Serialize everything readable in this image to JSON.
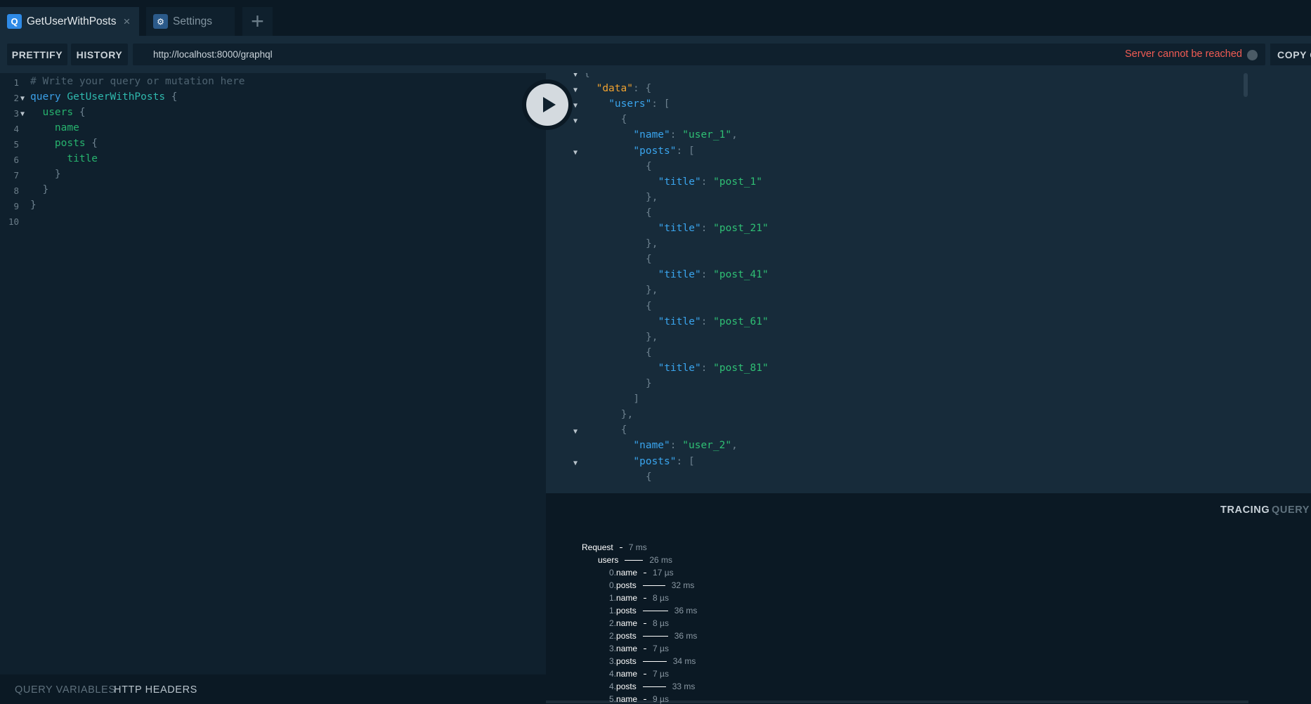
{
  "tabs": [
    {
      "badge": "Q",
      "label": "GetUserWithPosts",
      "close": "×"
    },
    {
      "badge": "⚙",
      "label": "Settings"
    }
  ],
  "add_tab_label": "+",
  "toolbar": {
    "prettify": "PRETTIFY",
    "history": "HISTORY",
    "url": "http://localhost:8000/graphql",
    "server_status": "Server cannot be reached",
    "copy": "COPY CURL"
  },
  "editor": {
    "lines": [
      {
        "num": "1",
        "fold": "",
        "segs": [
          {
            "t": "# Write your query or mutation here",
            "c": "c-comment"
          }
        ]
      },
      {
        "num": "2",
        "fold": "▼",
        "segs": [
          {
            "t": "query ",
            "c": "c-kw"
          },
          {
            "t": "GetUserWithPosts",
            "c": "c-def"
          },
          {
            "t": " {",
            "c": "c-punct"
          }
        ]
      },
      {
        "num": "3",
        "fold": "▼",
        "segs": [
          {
            "t": "  users",
            "c": "c-field"
          },
          {
            "t": " {",
            "c": "c-punct"
          }
        ]
      },
      {
        "num": "4",
        "fold": "",
        "segs": [
          {
            "t": "    name",
            "c": "c-field"
          }
        ]
      },
      {
        "num": "5",
        "fold": "",
        "segs": [
          {
            "t": "    posts",
            "c": "c-field"
          },
          {
            "t": " {",
            "c": "c-punct"
          }
        ]
      },
      {
        "num": "6",
        "fold": "",
        "segs": [
          {
            "t": "      title",
            "c": "c-field"
          }
        ]
      },
      {
        "num": "7",
        "fold": "",
        "segs": [
          {
            "t": "    }",
            "c": "c-punct"
          }
        ]
      },
      {
        "num": "8",
        "fold": "",
        "segs": [
          {
            "t": "  }",
            "c": "c-punct"
          }
        ]
      },
      {
        "num": "9",
        "fold": "",
        "segs": [
          {
            "t": "}",
            "c": "c-punct"
          }
        ]
      },
      {
        "num": "10",
        "fold": "",
        "segs": []
      }
    ]
  },
  "bottom_tabs": {
    "variables": "QUERY VARIABLES",
    "headers": "HTTP HEADERS"
  },
  "result": {
    "lines": [
      {
        "fold": "▼",
        "indent": 0,
        "segs": [
          {
            "t": "{",
            "c": "j-p"
          }
        ]
      },
      {
        "fold": "▼",
        "indent": 1,
        "segs": [
          {
            "t": "\"data\"",
            "c": "j-k-top"
          },
          {
            "t": ": {",
            "c": "j-p"
          }
        ]
      },
      {
        "fold": "▼",
        "indent": 2,
        "segs": [
          {
            "t": "\"users\"",
            "c": "j-k"
          },
          {
            "t": ": [",
            "c": "j-p"
          }
        ]
      },
      {
        "fold": "▼",
        "indent": 3,
        "segs": [
          {
            "t": "{",
            "c": "j-p"
          }
        ]
      },
      {
        "fold": "",
        "indent": 4,
        "segs": [
          {
            "t": "\"name\"",
            "c": "j-k"
          },
          {
            "t": ": ",
            "c": "j-p"
          },
          {
            "t": "\"user_1\"",
            "c": "j-s"
          },
          {
            "t": ",",
            "c": "j-p"
          }
        ]
      },
      {
        "fold": "▼",
        "indent": 4,
        "segs": [
          {
            "t": "\"posts\"",
            "c": "j-k"
          },
          {
            "t": ": [",
            "c": "j-p"
          }
        ]
      },
      {
        "fold": "",
        "indent": 5,
        "segs": [
          {
            "t": "{",
            "c": "j-p"
          }
        ]
      },
      {
        "fold": "",
        "indent": 6,
        "segs": [
          {
            "t": "\"title\"",
            "c": "j-k"
          },
          {
            "t": ": ",
            "c": "j-p"
          },
          {
            "t": "\"post_1\"",
            "c": "j-s"
          }
        ]
      },
      {
        "fold": "",
        "indent": 5,
        "segs": [
          {
            "t": "},",
            "c": "j-p"
          }
        ]
      },
      {
        "fold": "",
        "indent": 5,
        "segs": [
          {
            "t": "{",
            "c": "j-p"
          }
        ]
      },
      {
        "fold": "",
        "indent": 6,
        "segs": [
          {
            "t": "\"title\"",
            "c": "j-k"
          },
          {
            "t": ": ",
            "c": "j-p"
          },
          {
            "t": "\"post_21\"",
            "c": "j-s"
          }
        ]
      },
      {
        "fold": "",
        "indent": 5,
        "segs": [
          {
            "t": "},",
            "c": "j-p"
          }
        ]
      },
      {
        "fold": "",
        "indent": 5,
        "segs": [
          {
            "t": "{",
            "c": "j-p"
          }
        ]
      },
      {
        "fold": "",
        "indent": 6,
        "segs": [
          {
            "t": "\"title\"",
            "c": "j-k"
          },
          {
            "t": ": ",
            "c": "j-p"
          },
          {
            "t": "\"post_41\"",
            "c": "j-s"
          }
        ]
      },
      {
        "fold": "",
        "indent": 5,
        "segs": [
          {
            "t": "},",
            "c": "j-p"
          }
        ]
      },
      {
        "fold": "",
        "indent": 5,
        "segs": [
          {
            "t": "{",
            "c": "j-p"
          }
        ]
      },
      {
        "fold": "",
        "indent": 6,
        "segs": [
          {
            "t": "\"title\"",
            "c": "j-k"
          },
          {
            "t": ": ",
            "c": "j-p"
          },
          {
            "t": "\"post_61\"",
            "c": "j-s"
          }
        ]
      },
      {
        "fold": "",
        "indent": 5,
        "segs": [
          {
            "t": "},",
            "c": "j-p"
          }
        ]
      },
      {
        "fold": "",
        "indent": 5,
        "segs": [
          {
            "t": "{",
            "c": "j-p"
          }
        ]
      },
      {
        "fold": "",
        "indent": 6,
        "segs": [
          {
            "t": "\"title\"",
            "c": "j-k"
          },
          {
            "t": ": ",
            "c": "j-p"
          },
          {
            "t": "\"post_81\"",
            "c": "j-s"
          }
        ]
      },
      {
        "fold": "",
        "indent": 5,
        "segs": [
          {
            "t": "}",
            "c": "j-p"
          }
        ]
      },
      {
        "fold": "",
        "indent": 4,
        "segs": [
          {
            "t": "]",
            "c": "j-p"
          }
        ]
      },
      {
        "fold": "",
        "indent": 3,
        "segs": [
          {
            "t": "},",
            "c": "j-p"
          }
        ]
      },
      {
        "fold": "▼",
        "indent": 3,
        "segs": [
          {
            "t": "{",
            "c": "j-p"
          }
        ]
      },
      {
        "fold": "",
        "indent": 4,
        "segs": [
          {
            "t": "\"name\"",
            "c": "j-k"
          },
          {
            "t": ": ",
            "c": "j-p"
          },
          {
            "t": "\"user_2\"",
            "c": "j-s"
          },
          {
            "t": ",",
            "c": "j-p"
          }
        ]
      },
      {
        "fold": "▼",
        "indent": 4,
        "segs": [
          {
            "t": "\"posts\"",
            "c": "j-k"
          },
          {
            "t": ": [",
            "c": "j-p"
          }
        ]
      },
      {
        "fold": "",
        "indent": 5,
        "segs": [
          {
            "t": "{",
            "c": "j-p"
          }
        ]
      }
    ]
  },
  "tracing": {
    "tabs": {
      "tracing": "TRACING",
      "query_plan": "QUERY PLAN"
    },
    "rows": [
      {
        "prefix": "",
        "name": "Request",
        "duration": "7 ms",
        "level": 0,
        "bar": 0.03
      },
      {
        "prefix": "",
        "name": "users",
        "duration": "26 ms",
        "level": 1,
        "bar": 0.72
      },
      {
        "prefix": "0.",
        "name": "name",
        "duration": "17 µs",
        "level": 2,
        "bar": 0.01
      },
      {
        "prefix": "0.",
        "name": "posts",
        "duration": "32 ms",
        "level": 2,
        "bar": 0.89
      },
      {
        "prefix": "1.",
        "name": "name",
        "duration": "8 µs",
        "level": 2,
        "bar": 0.01
      },
      {
        "prefix": "1.",
        "name": "posts",
        "duration": "36 ms",
        "level": 2,
        "bar": 1.0
      },
      {
        "prefix": "2.",
        "name": "name",
        "duration": "8 µs",
        "level": 2,
        "bar": 0.01
      },
      {
        "prefix": "2.",
        "name": "posts",
        "duration": "36 ms",
        "level": 2,
        "bar": 1.0
      },
      {
        "prefix": "3.",
        "name": "name",
        "duration": "7 µs",
        "level": 2,
        "bar": 0.01
      },
      {
        "prefix": "3.",
        "name": "posts",
        "duration": "34 ms",
        "level": 2,
        "bar": 0.94
      },
      {
        "prefix": "4.",
        "name": "name",
        "duration": "7 µs",
        "level": 2,
        "bar": 0.01
      },
      {
        "prefix": "4.",
        "name": "posts",
        "duration": "33 ms",
        "level": 2,
        "bar": 0.92
      },
      {
        "prefix": "5.",
        "name": "name",
        "duration": "9 µs",
        "level": 2,
        "bar": 0.01
      }
    ]
  },
  "colors": {
    "server_error": "#f25c54",
    "json_key": "#3aa5ee",
    "json_string": "#2fbf74",
    "json_top_key": "#f0a230",
    "query_keyword": "#3ba0e8",
    "field": "#27b36e"
  },
  "icons": {
    "query_badge": "query-icon",
    "settings_badge": "gear-icon",
    "add": "plus-icon",
    "close": "close-icon",
    "play": "play-icon",
    "status": "status-dot-icon"
  }
}
